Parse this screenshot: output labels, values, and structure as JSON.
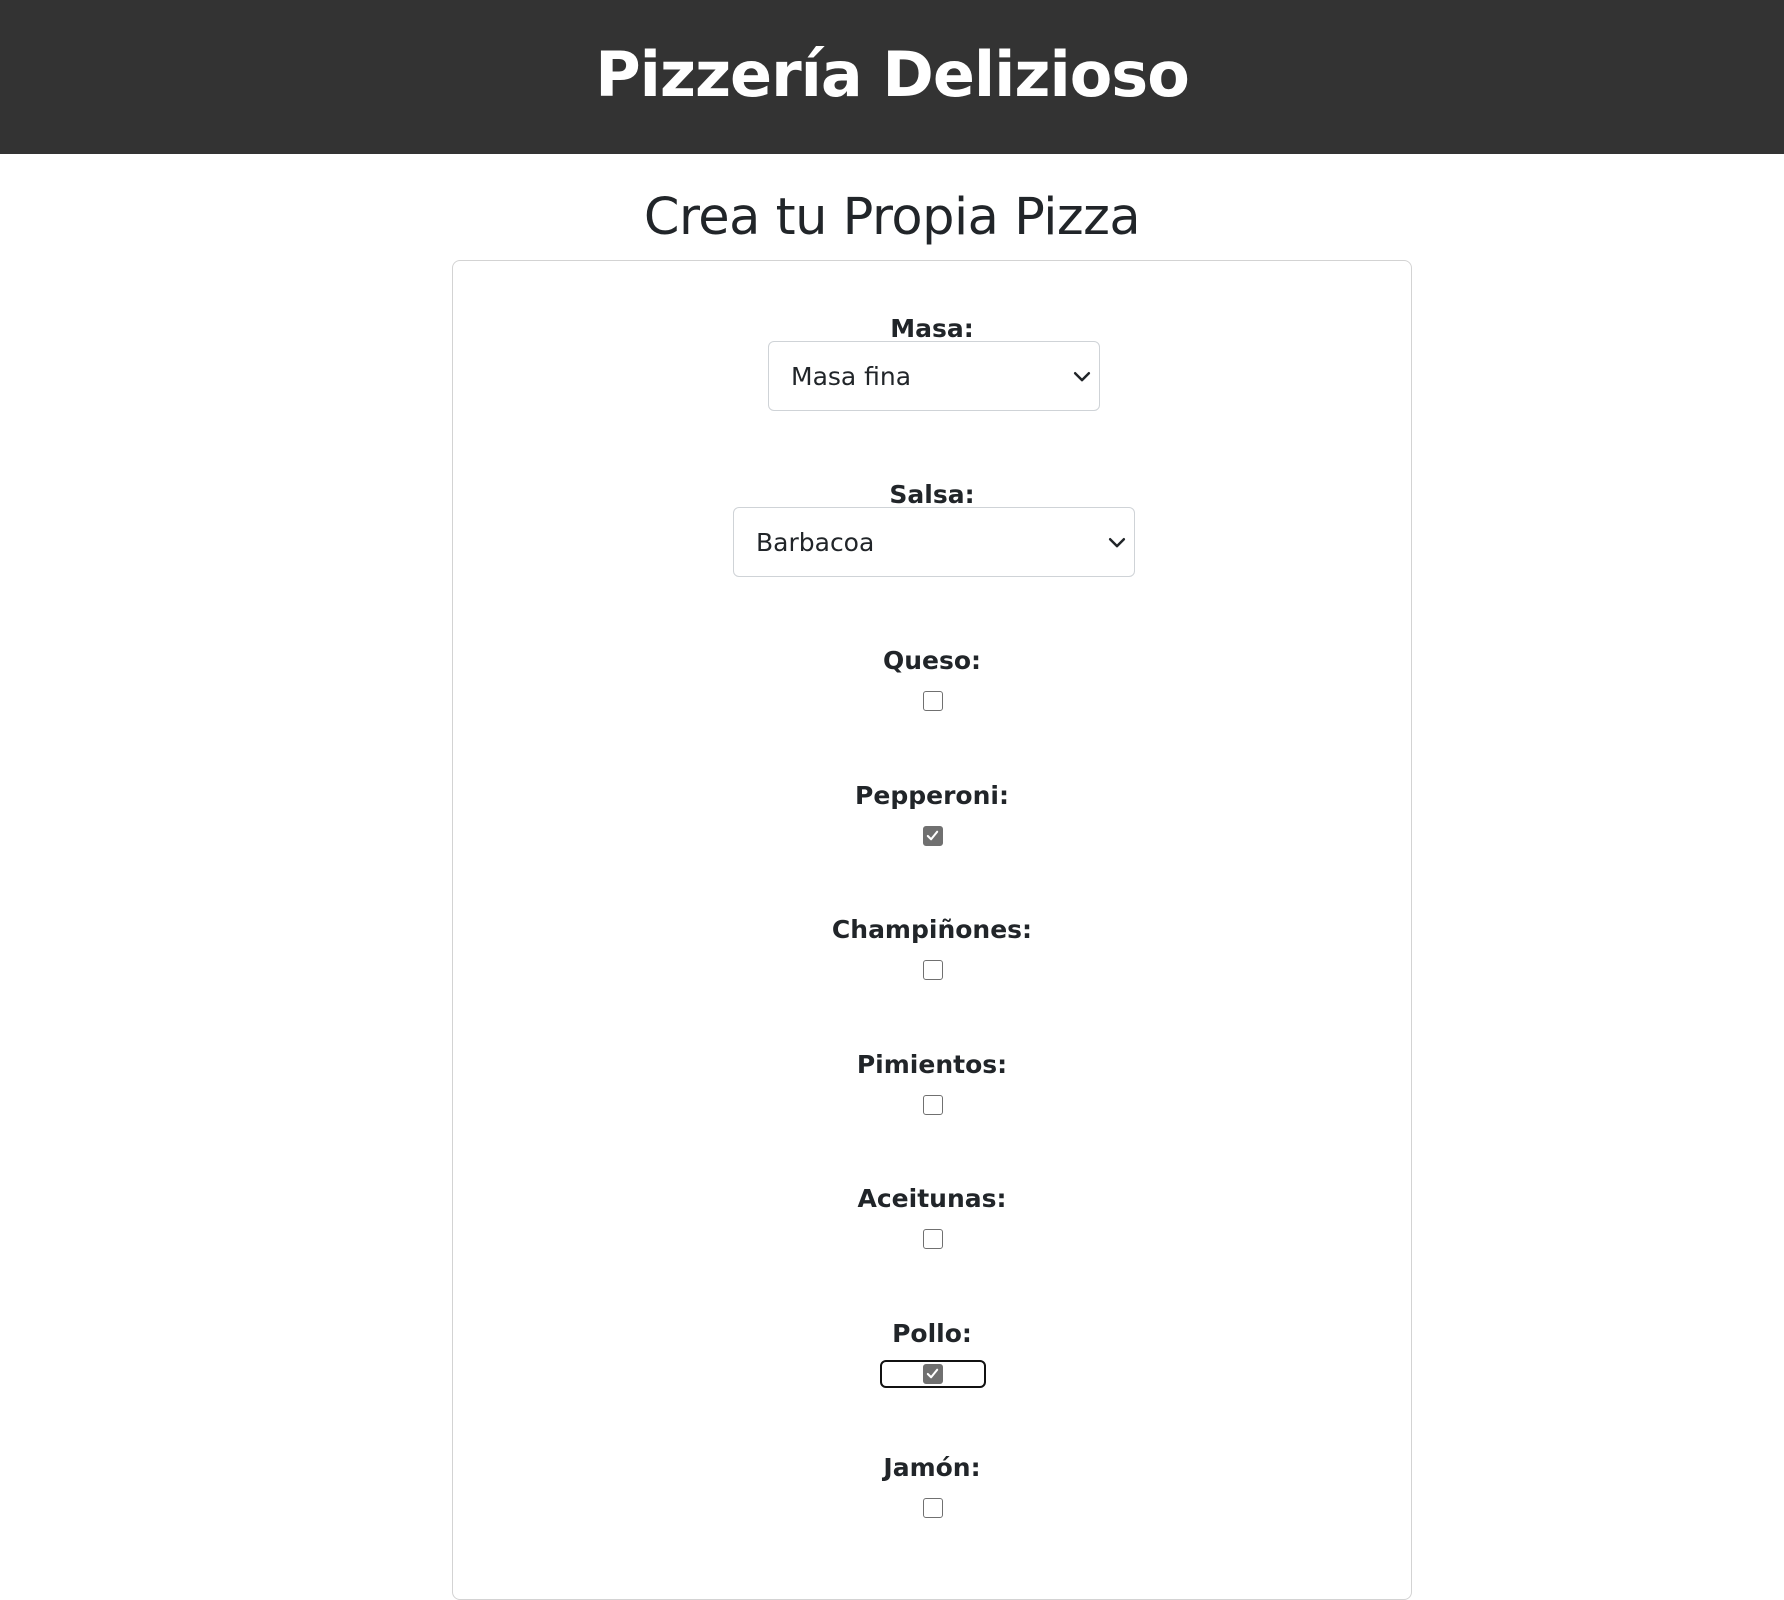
{
  "header": {
    "title": "Pizzería Delizioso"
  },
  "page": {
    "title": "Crea tu Propia Pizza"
  },
  "form": {
    "masa": {
      "label": "Masa:",
      "value": "Masa fina"
    },
    "salsa": {
      "label": "Salsa:",
      "value": "Barbacoa"
    },
    "toppings": [
      {
        "label": "Queso:",
        "checked": false
      },
      {
        "label": "Pepperoni:",
        "checked": true
      },
      {
        "label": "Champiñones:",
        "checked": false
      },
      {
        "label": "Pimientos:",
        "checked": false
      },
      {
        "label": "Aceitunas:",
        "checked": false
      },
      {
        "label": "Pollo:",
        "checked": true,
        "focused": true
      },
      {
        "label": "Jamón:",
        "checked": false
      }
    ]
  },
  "colors": {
    "header_bg": "#333333",
    "header_text": "#ffffff",
    "text": "#212529",
    "checkbox_checked": "#707070"
  },
  "icons": {
    "select_arrow": "chevron-down-icon",
    "checkmark": "check-icon"
  }
}
